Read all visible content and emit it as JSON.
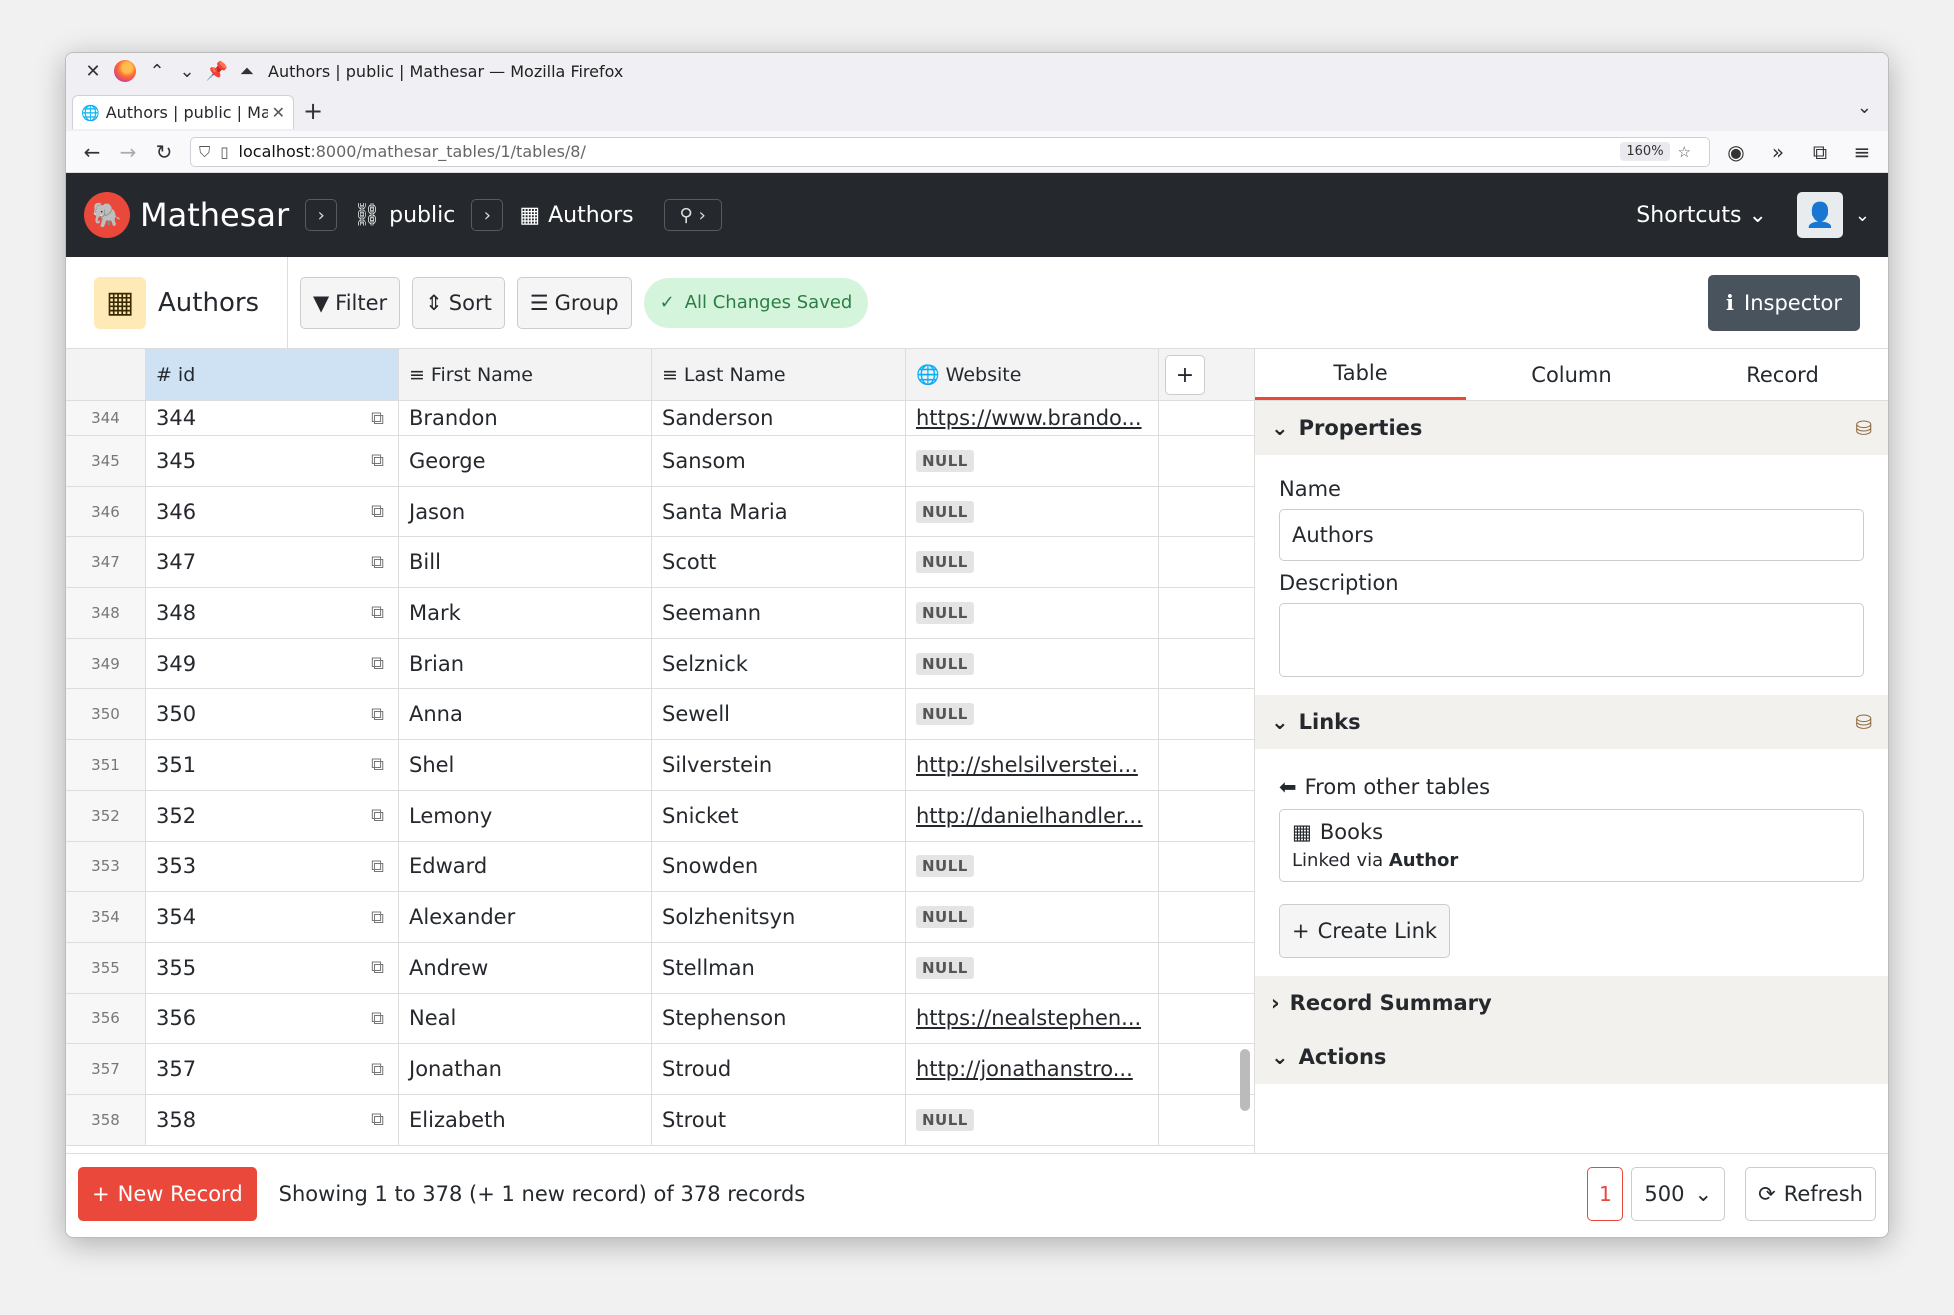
{
  "browser": {
    "window_title": "Authors | public | Mathesar — Mozilla Firefox",
    "tab_title": "Authors | public | Mathesar",
    "url_host": "localhost",
    "url_path": ":8000/mathesar_tables/1/tables/8/",
    "zoom": "160%"
  },
  "app": {
    "brand": "Mathesar",
    "schema": "public",
    "table": "Authors",
    "shortcuts_label": "Shortcuts"
  },
  "toolbar": {
    "title": "Authors",
    "filter_label": "Filter",
    "sort_label": "Sort",
    "group_label": "Group",
    "saved_label": "All Changes Saved",
    "inspector_label": "Inspector"
  },
  "grid": {
    "columns": [
      "id",
      "First Name",
      "Last Name",
      "Website"
    ],
    "null_label": "NULL",
    "rows": [
      {
        "n": "344",
        "id": "344",
        "first": "Brandon",
        "last": "Sanderson",
        "web": "https://www.brando..."
      },
      {
        "n": "345",
        "id": "345",
        "first": "George",
        "last": "Sansom",
        "web": null
      },
      {
        "n": "346",
        "id": "346",
        "first": "Jason",
        "last": "Santa Maria",
        "web": null
      },
      {
        "n": "347",
        "id": "347",
        "first": "Bill",
        "last": "Scott",
        "web": null
      },
      {
        "n": "348",
        "id": "348",
        "first": "Mark",
        "last": "Seemann",
        "web": null
      },
      {
        "n": "349",
        "id": "349",
        "first": "Brian",
        "last": "Selznick",
        "web": null
      },
      {
        "n": "350",
        "id": "350",
        "first": "Anna",
        "last": "Sewell",
        "web": null
      },
      {
        "n": "351",
        "id": "351",
        "first": "Shel",
        "last": "Silverstein",
        "web": "http://shelsilverstei..."
      },
      {
        "n": "352",
        "id": "352",
        "first": "Lemony",
        "last": "Snicket",
        "web": "http://danielhandler..."
      },
      {
        "n": "353",
        "id": "353",
        "first": "Edward",
        "last": "Snowden",
        "web": null
      },
      {
        "n": "354",
        "id": "354",
        "first": "Alexander",
        "last": "Solzhenitsyn",
        "web": null
      },
      {
        "n": "355",
        "id": "355",
        "first": "Andrew",
        "last": "Stellman",
        "web": null
      },
      {
        "n": "356",
        "id": "356",
        "first": "Neal",
        "last": "Stephenson",
        "web": "https://nealstephen..."
      },
      {
        "n": "357",
        "id": "357",
        "first": "Jonathan",
        "last": "Stroud",
        "web": "http://jonathanstro..."
      },
      {
        "n": "358",
        "id": "358",
        "first": "Elizabeth",
        "last": "Strout",
        "web": null
      }
    ]
  },
  "inspector": {
    "tabs": [
      "Table",
      "Column",
      "Record"
    ],
    "properties_label": "Properties",
    "name_label": "Name",
    "name_value": "Authors",
    "description_label": "Description",
    "links_label": "Links",
    "from_other_tables": "From other tables",
    "link_table": "Books",
    "linked_via_prefix": "Linked via",
    "linked_via_column": "Author",
    "create_link_label": "Create Link",
    "record_summary_label": "Record Summary",
    "actions_label": "Actions"
  },
  "footer": {
    "new_record_label": "New Record",
    "showing_text": "Showing 1 to 378 (+ 1 new record) of 378 records",
    "page": "1",
    "page_size": "500",
    "refresh_label": "Refresh"
  }
}
